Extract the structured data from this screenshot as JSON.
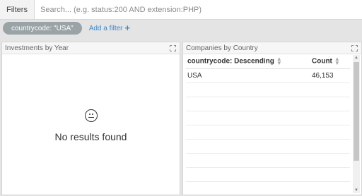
{
  "topbar": {
    "filters_label": "Filters",
    "search_placeholder": "Search... (e.g. status:200 AND extension:PHP)"
  },
  "filterbar": {
    "pill_label": "countrycode: \"USA\"",
    "add_filter_label": "Add a filter",
    "add_icon": "+"
  },
  "left_panel": {
    "title": "Investments by Year",
    "empty_icon": "smile-icon",
    "empty_message": "No results found"
  },
  "right_panel": {
    "title": "Companies by Country",
    "table": {
      "columns": [
        "countrycode: Descending",
        "Count"
      ],
      "rows": [
        [
          "USA",
          "46,153"
        ]
      ]
    }
  }
}
